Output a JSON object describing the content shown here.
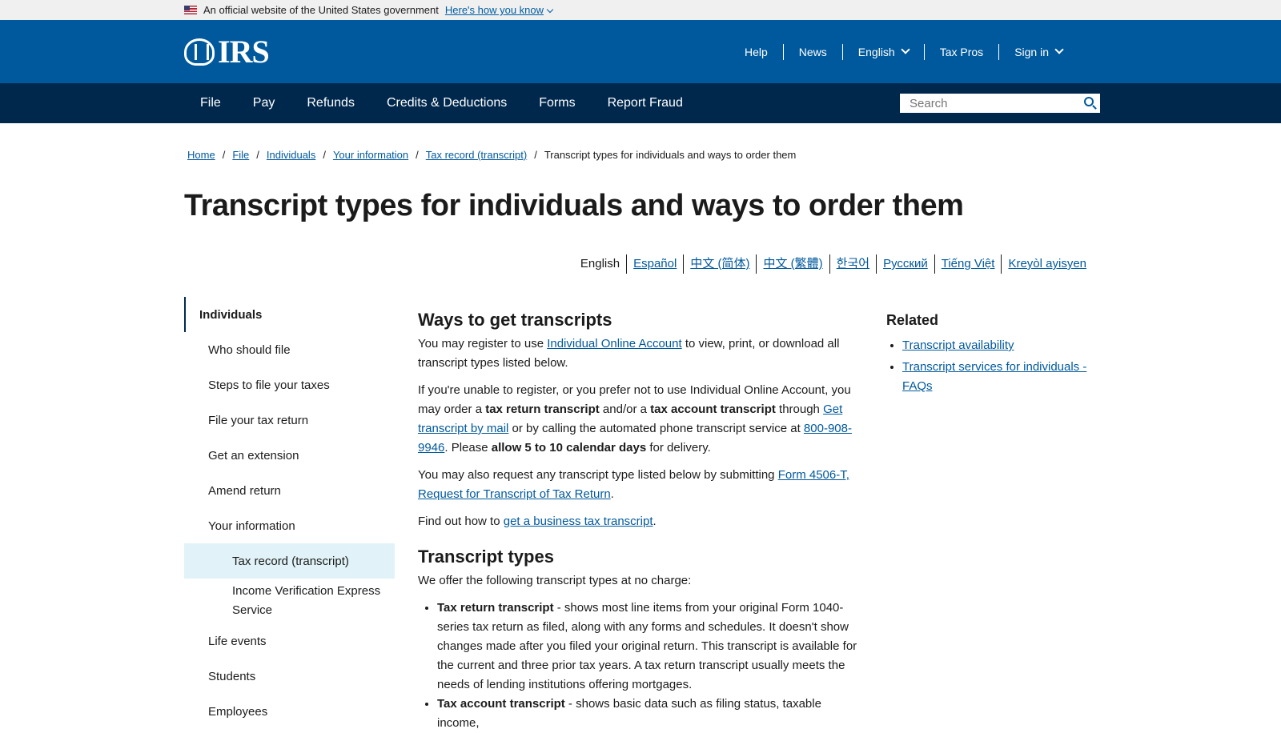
{
  "banner": {
    "text": "An official website of the United States government",
    "link": "Here's how you know"
  },
  "header": {
    "logo_text": "IRS",
    "util": [
      "Help",
      "News",
      "English",
      "Tax Pros",
      "Sign in"
    ]
  },
  "nav": {
    "items": [
      "File",
      "Pay",
      "Refunds",
      "Credits & Deductions",
      "Forms",
      "Report Fraud"
    ],
    "search_placeholder": "Search"
  },
  "breadcrumb": [
    "Home",
    "File",
    "Individuals",
    "Your information",
    "Tax record (transcript)",
    "Transcript types for individuals and ways to order them"
  ],
  "title": "Transcript types for individuals and ways to order them",
  "languages": [
    "English",
    "Español",
    "中文 (简体)",
    "中文 (繁體)",
    "한국어",
    "Русский",
    "Tiếng Việt",
    "Kreyòl ayisyen"
  ],
  "sidenav": {
    "top": "Individuals",
    "items": [
      "Who should file",
      "Steps to file your taxes",
      "File your tax return",
      "Get an extension",
      "Amend return",
      "Your information"
    ],
    "sub": [
      "Tax record (transcript)",
      "Income Verification Express Service"
    ],
    "more": [
      "Life events",
      "Students",
      "Employees"
    ]
  },
  "content": {
    "h1": "Ways to get transcripts",
    "p1_a": "You may register to use ",
    "p1_link": "Individual Online Account",
    "p1_b": " to view, print, or download all transcript types listed below.",
    "p2_a": "If you're unable to register, or you prefer not to use Individual Online Account, you may order a ",
    "p2_b1": "tax return transcript",
    "p2_c": " and/or a ",
    "p2_b2": "tax account transcript",
    "p2_d": " through ",
    "p2_link1": "Get transcript by mail",
    "p2_e": " or by calling the automated phone transcript service at ",
    "p2_link2": "800-908-9946",
    "p2_f": ". Please ",
    "p2_b3": "allow 5 to 10 calendar days",
    "p2_g": " for delivery.",
    "p3_a": "You may also request any transcript type listed below by submitting ",
    "p3_link": "Form 4506-T, Request for Transcript of Tax Return",
    "p3_b": ".",
    "p4_a": "Find out how to ",
    "p4_link": "get a business tax transcript",
    "p4_b": ".",
    "h2": "Transcript types",
    "p5": "We offer the following transcript types at no charge:",
    "li1_b": "Tax return transcript",
    "li1_t": " - shows most line items from your original Form 1040-series tax return as filed, along with any forms and schedules. It doesn't show changes made after you filed your original return. This transcript is available for the current and three prior tax years. A tax return transcript usually meets the needs of lending institutions offering mortgages.",
    "li2_b": "Tax account transcript",
    "li2_t": " - shows basic data such as filing status, taxable income,"
  },
  "related": {
    "title": "Related",
    "links": [
      "Transcript availability",
      "Transcript services for individuals - FAQs"
    ]
  }
}
